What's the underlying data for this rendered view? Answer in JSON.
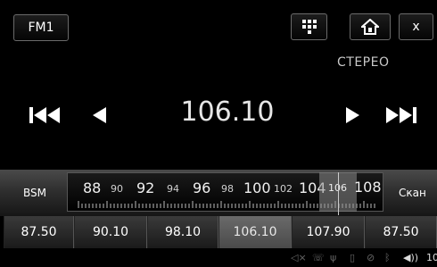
{
  "header": {
    "band_label": "FM1",
    "close_label": "x",
    "stereo_label": "СТЕРЕО"
  },
  "tuner": {
    "frequency": "106.10",
    "bsm_label": "BSM",
    "scan_label": "Скан",
    "scale_large": [
      "88",
      "92",
      "96",
      "100",
      "104",
      "108"
    ],
    "scale_small": [
      "90",
      "94",
      "98",
      "102",
      "106"
    ]
  },
  "presets": [
    "87.50",
    "90.10",
    "98.10",
    "106.10",
    "107.90",
    "87.50"
  ],
  "active_preset_index": 3,
  "status": {
    "clock": "10"
  },
  "colors": {
    "background": "#000000",
    "bar_top": "#4a4a4a",
    "active_preset": "#5a5a5a"
  },
  "icons": [
    "grid-menu-icon",
    "home-icon",
    "skip-back-icon",
    "step-back-icon",
    "step-forward-icon",
    "skip-forward-icon",
    "volume-icon"
  ]
}
